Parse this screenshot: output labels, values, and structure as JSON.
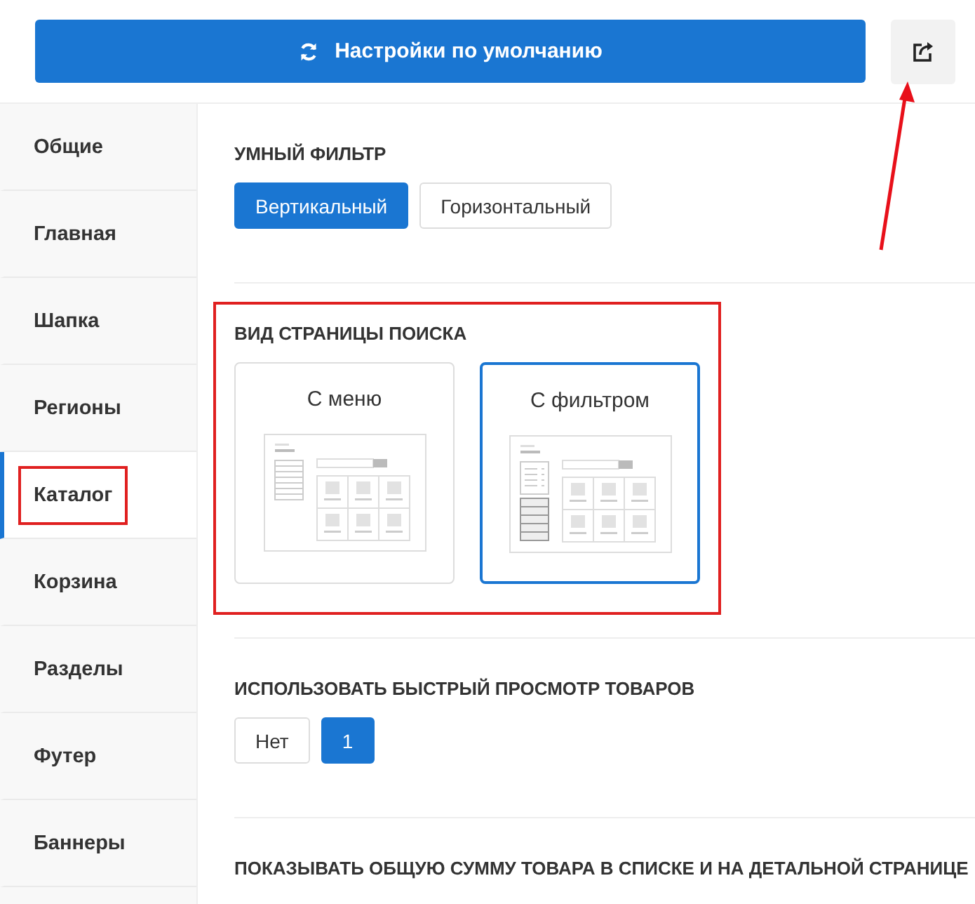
{
  "header": {
    "reset_button": "Настройки по умолчанию"
  },
  "sidebar": {
    "items": [
      {
        "label": "Общие",
        "selected": false,
        "highlighted": false
      },
      {
        "label": "Главная",
        "selected": false,
        "highlighted": false
      },
      {
        "label": "Шапка",
        "selected": false,
        "highlighted": false
      },
      {
        "label": "Регионы",
        "selected": false,
        "highlighted": false
      },
      {
        "label": "Каталог",
        "selected": true,
        "highlighted": true
      },
      {
        "label": "Корзина",
        "selected": false,
        "highlighted": false
      },
      {
        "label": "Разделы",
        "selected": false,
        "highlighted": false
      },
      {
        "label": "Футер",
        "selected": false,
        "highlighted": false
      },
      {
        "label": "Баннеры",
        "selected": false,
        "highlighted": false
      }
    ]
  },
  "sections": [
    {
      "kind": "buttons",
      "title": "УМНЫЙ ФИЛЬТР",
      "highlighted": false,
      "options": [
        {
          "label": "Вертикальный",
          "selected": true
        },
        {
          "label": "Горизонтальный",
          "selected": false
        }
      ]
    },
    {
      "kind": "cards",
      "title": "ВИД СТРАНИЦЫ ПОИСКА",
      "highlighted": true,
      "options": [
        {
          "label": "С меню",
          "selected": false,
          "kind": "menu"
        },
        {
          "label": "С фильтром",
          "selected": true,
          "kind": "filter"
        }
      ]
    },
    {
      "kind": "buttons",
      "title": "ИСПОЛЬЗОВАТЬ БЫСТРЫЙ ПРОСМОТР ТОВАРОВ",
      "highlighted": false,
      "options": [
        {
          "label": "Нет",
          "selected": false
        },
        {
          "label": "1",
          "selected": true
        }
      ]
    },
    {
      "kind": "title",
      "title": "ПОКАЗЫВАТЬ ОБЩУЮ СУММУ ТОВАРА В СПИСКЕ И НА ДЕТАЛЬНОЙ СТРАНИЦЕ",
      "highlighted": false
    }
  ]
}
